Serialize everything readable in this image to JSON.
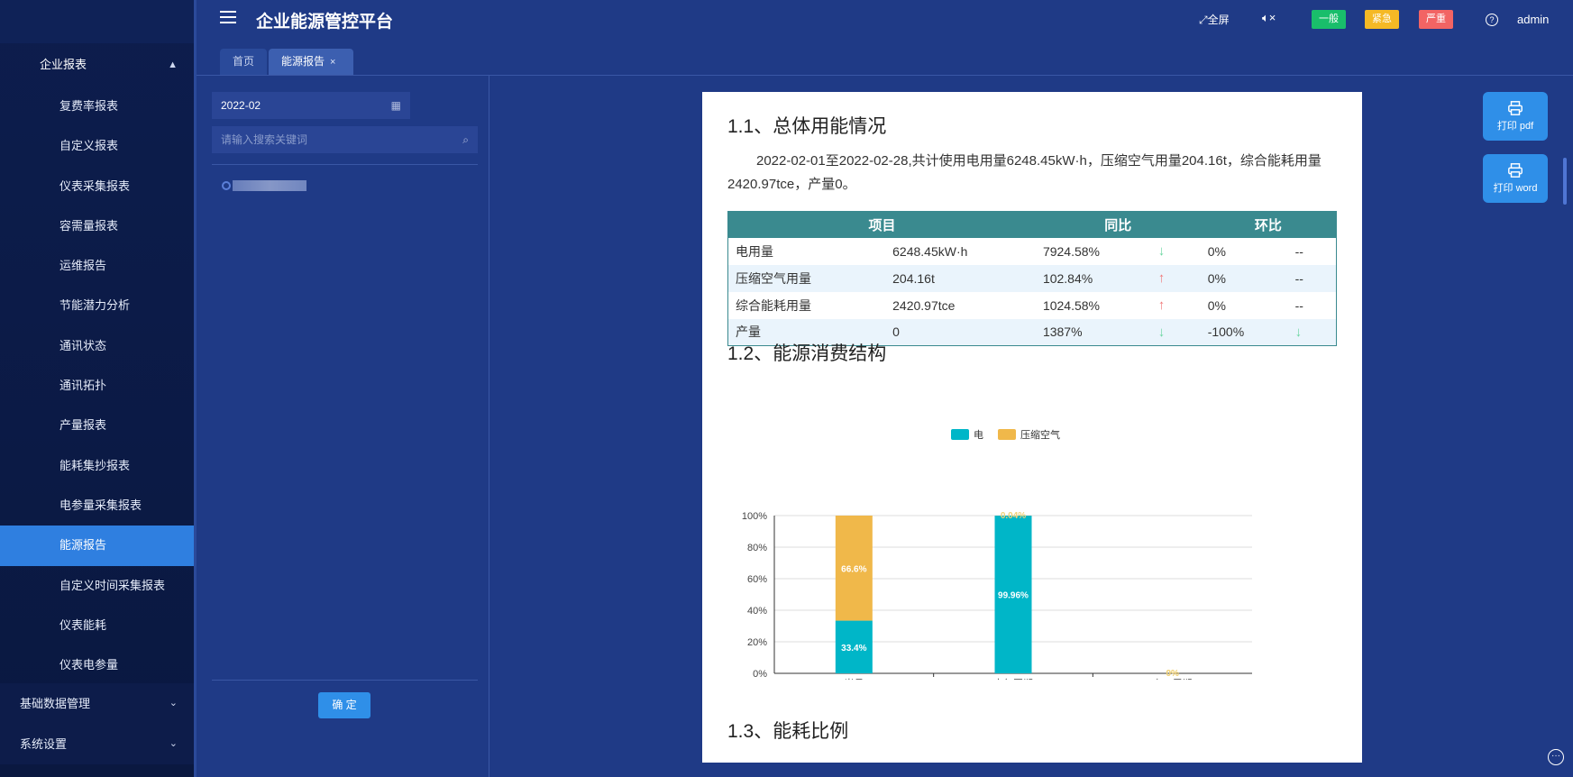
{
  "header": {
    "title": "企业能源管控平台",
    "fullscreen_label": "全屏",
    "mute_icon": "mute-icon",
    "badges": {
      "general": "一般",
      "urgent": "紧急",
      "severe": "严重"
    },
    "user": "admin"
  },
  "sidebar": {
    "group_title": "企业报表",
    "items": [
      "复费率报表",
      "自定义报表",
      "仪表采集报表",
      "容需量报表",
      "运维报告",
      "节能潜力分析",
      "通讯状态",
      "通讯拓扑",
      "产量报表",
      "能耗集抄报表",
      "电参量采集报表",
      "能源报告",
      "自定义时间采集报表",
      "仪表能耗",
      "仪表电参量"
    ],
    "active_index": 11,
    "bottom_groups": [
      "基础数据管理",
      "系统设置"
    ]
  },
  "tabs": {
    "home": "首页",
    "active": "能源报告",
    "close": "×"
  },
  "left_panel": {
    "date_value": "2022-02",
    "search_placeholder": "请输入搜索关键词",
    "confirm_label": "确 定"
  },
  "report": {
    "s1_title": "1.1、总体用能情况",
    "s1_text": "2022-02-01至2022-02-28,共计使用电用量6248.45kW·h，压缩空气用量204.16t，综合能耗用量2420.97tce，产量0。",
    "table_headers": [
      "项目",
      "同比",
      "环比"
    ],
    "rows": [
      {
        "name": "电用量",
        "value": "6248.45kW·h",
        "yoy": "7924.58%",
        "yoy_dir": "down",
        "mom": "0%",
        "mom_dir": "--"
      },
      {
        "name": "压缩空气用量",
        "value": "204.16t",
        "yoy": "102.84%",
        "yoy_dir": "up",
        "mom": "0%",
        "mom_dir": "--"
      },
      {
        "name": "综合能耗用量",
        "value": "2420.97tce",
        "yoy": "1024.58%",
        "yoy_dir": "up",
        "mom": "0%",
        "mom_dir": "--"
      },
      {
        "name": "产量",
        "value": "0",
        "yoy": "1387%",
        "yoy_dir": "down",
        "mom": "-100%",
        "mom_dir": "down"
      }
    ],
    "s2_title": "1.2、能源消费结构",
    "s3_title": "1.3、能耗比例"
  },
  "chart_data": {
    "type": "bar",
    "stacked": true,
    "categories": [
      "当月",
      "去年同期",
      "上一周期"
    ],
    "series": [
      {
        "name": "电",
        "color": "#00b6c8",
        "values": [
          33.4,
          99.96,
          0
        ]
      },
      {
        "name": "压缩空气",
        "color": "#f0b84a",
        "values": [
          66.6,
          0.04,
          0
        ]
      }
    ],
    "data_labels": [
      [
        "33.4%",
        "66.6%"
      ],
      [
        "99.96%",
        "0.04%"
      ],
      [
        "0%",
        "0%"
      ]
    ],
    "ylim": [
      0,
      100
    ],
    "yticks": [
      "0%",
      "20%",
      "40%",
      "60%",
      "80%",
      "100%"
    ],
    "legend": "top-center",
    "grid": true
  },
  "float_buttons": {
    "pdf": "打印 pdf",
    "word": "打印 word"
  }
}
